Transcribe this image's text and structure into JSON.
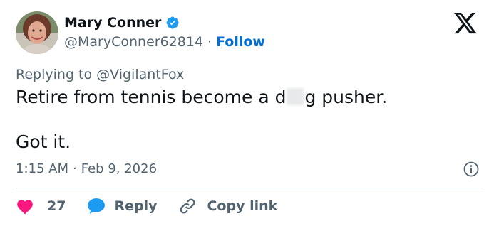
{
  "author": {
    "display_name": "Mary Conner",
    "handle": "@MaryConner62814",
    "separator": "·",
    "follow_label": "Follow"
  },
  "reply_context": {
    "prefix": "Replying to",
    "to_handle": "@VigilantFox"
  },
  "tweet": {
    "text_before_redaction": "Retire from tennis become a d",
    "text_after_redaction": "g pusher.",
    "second_line": "Got it."
  },
  "meta": {
    "time": "1:15 AM",
    "separator": "·",
    "date": "Feb 9, 2026"
  },
  "actions": {
    "like_count": "27",
    "reply_label": "Reply",
    "copy_link_label": "Copy link"
  },
  "colors": {
    "link_blue": "#006fd6",
    "verified_blue": "#1d9bf0",
    "like_red": "#f91880",
    "secondary_text": "#536471",
    "primary_text": "#0f1419"
  },
  "icons": [
    "verified-badge-icon",
    "x-logo-icon",
    "info-icon",
    "heart-icon",
    "reply-bubble-icon",
    "link-icon"
  ]
}
